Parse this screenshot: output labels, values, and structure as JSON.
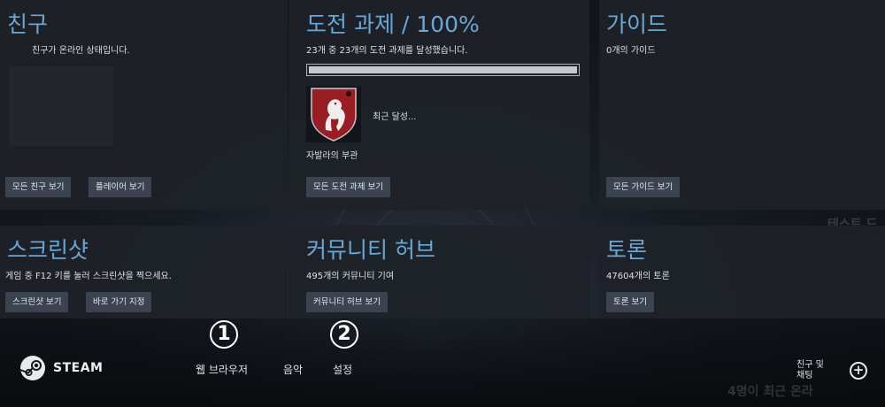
{
  "panels": {
    "friends": {
      "title": "친구",
      "text": "친구가 온라인 상태입니다.",
      "buttons": [
        "모든 친구 보기",
        "플레이어 보기"
      ]
    },
    "achievements": {
      "title": "도전 과제 / 100%",
      "text": "23개 중 23개의 도전 과제를 달성했습니다.",
      "progress": 1.0,
      "recent_label": "최근 달성...",
      "achievement_name": "자발라의 부관",
      "buttons": [
        "모든 도전 과제 보기"
      ]
    },
    "guides": {
      "title": "가이드",
      "text": "0개의 가이드",
      "buttons": [
        "모든 가이드 보기"
      ]
    },
    "screenshots": {
      "title": "스크린샷",
      "text": "게임 중 F12 키를 눌러 스크린샷을 찍으세요.",
      "buttons": [
        "스크린샷 보기",
        "바로 가기 지정"
      ]
    },
    "community": {
      "title": "커뮤니티 허브",
      "text": "495개의 커뮤니티 기여",
      "buttons": [
        "커뮤니티 허브 보기"
      ]
    },
    "discussions": {
      "title": "토론",
      "text": "47604개의 토론",
      "buttons": [
        "토론 보기"
      ]
    }
  },
  "bottom_bar": {
    "logo": "STEAM",
    "menu": [
      "웹 브라우저",
      "음악",
      "설정"
    ],
    "markers": [
      "1",
      "2"
    ],
    "friends_chat_line1": "친구 및",
    "friends_chat_line2": "채팅",
    "background_text_top": "테스트 드",
    "background_text_bottom": "4명이 최근 온라"
  },
  "colors": {
    "title_blue": "#67a8d7",
    "panel_bg": "#1e2228",
    "button_bg": "#3c4350",
    "badge_red": "#9a1d24"
  }
}
